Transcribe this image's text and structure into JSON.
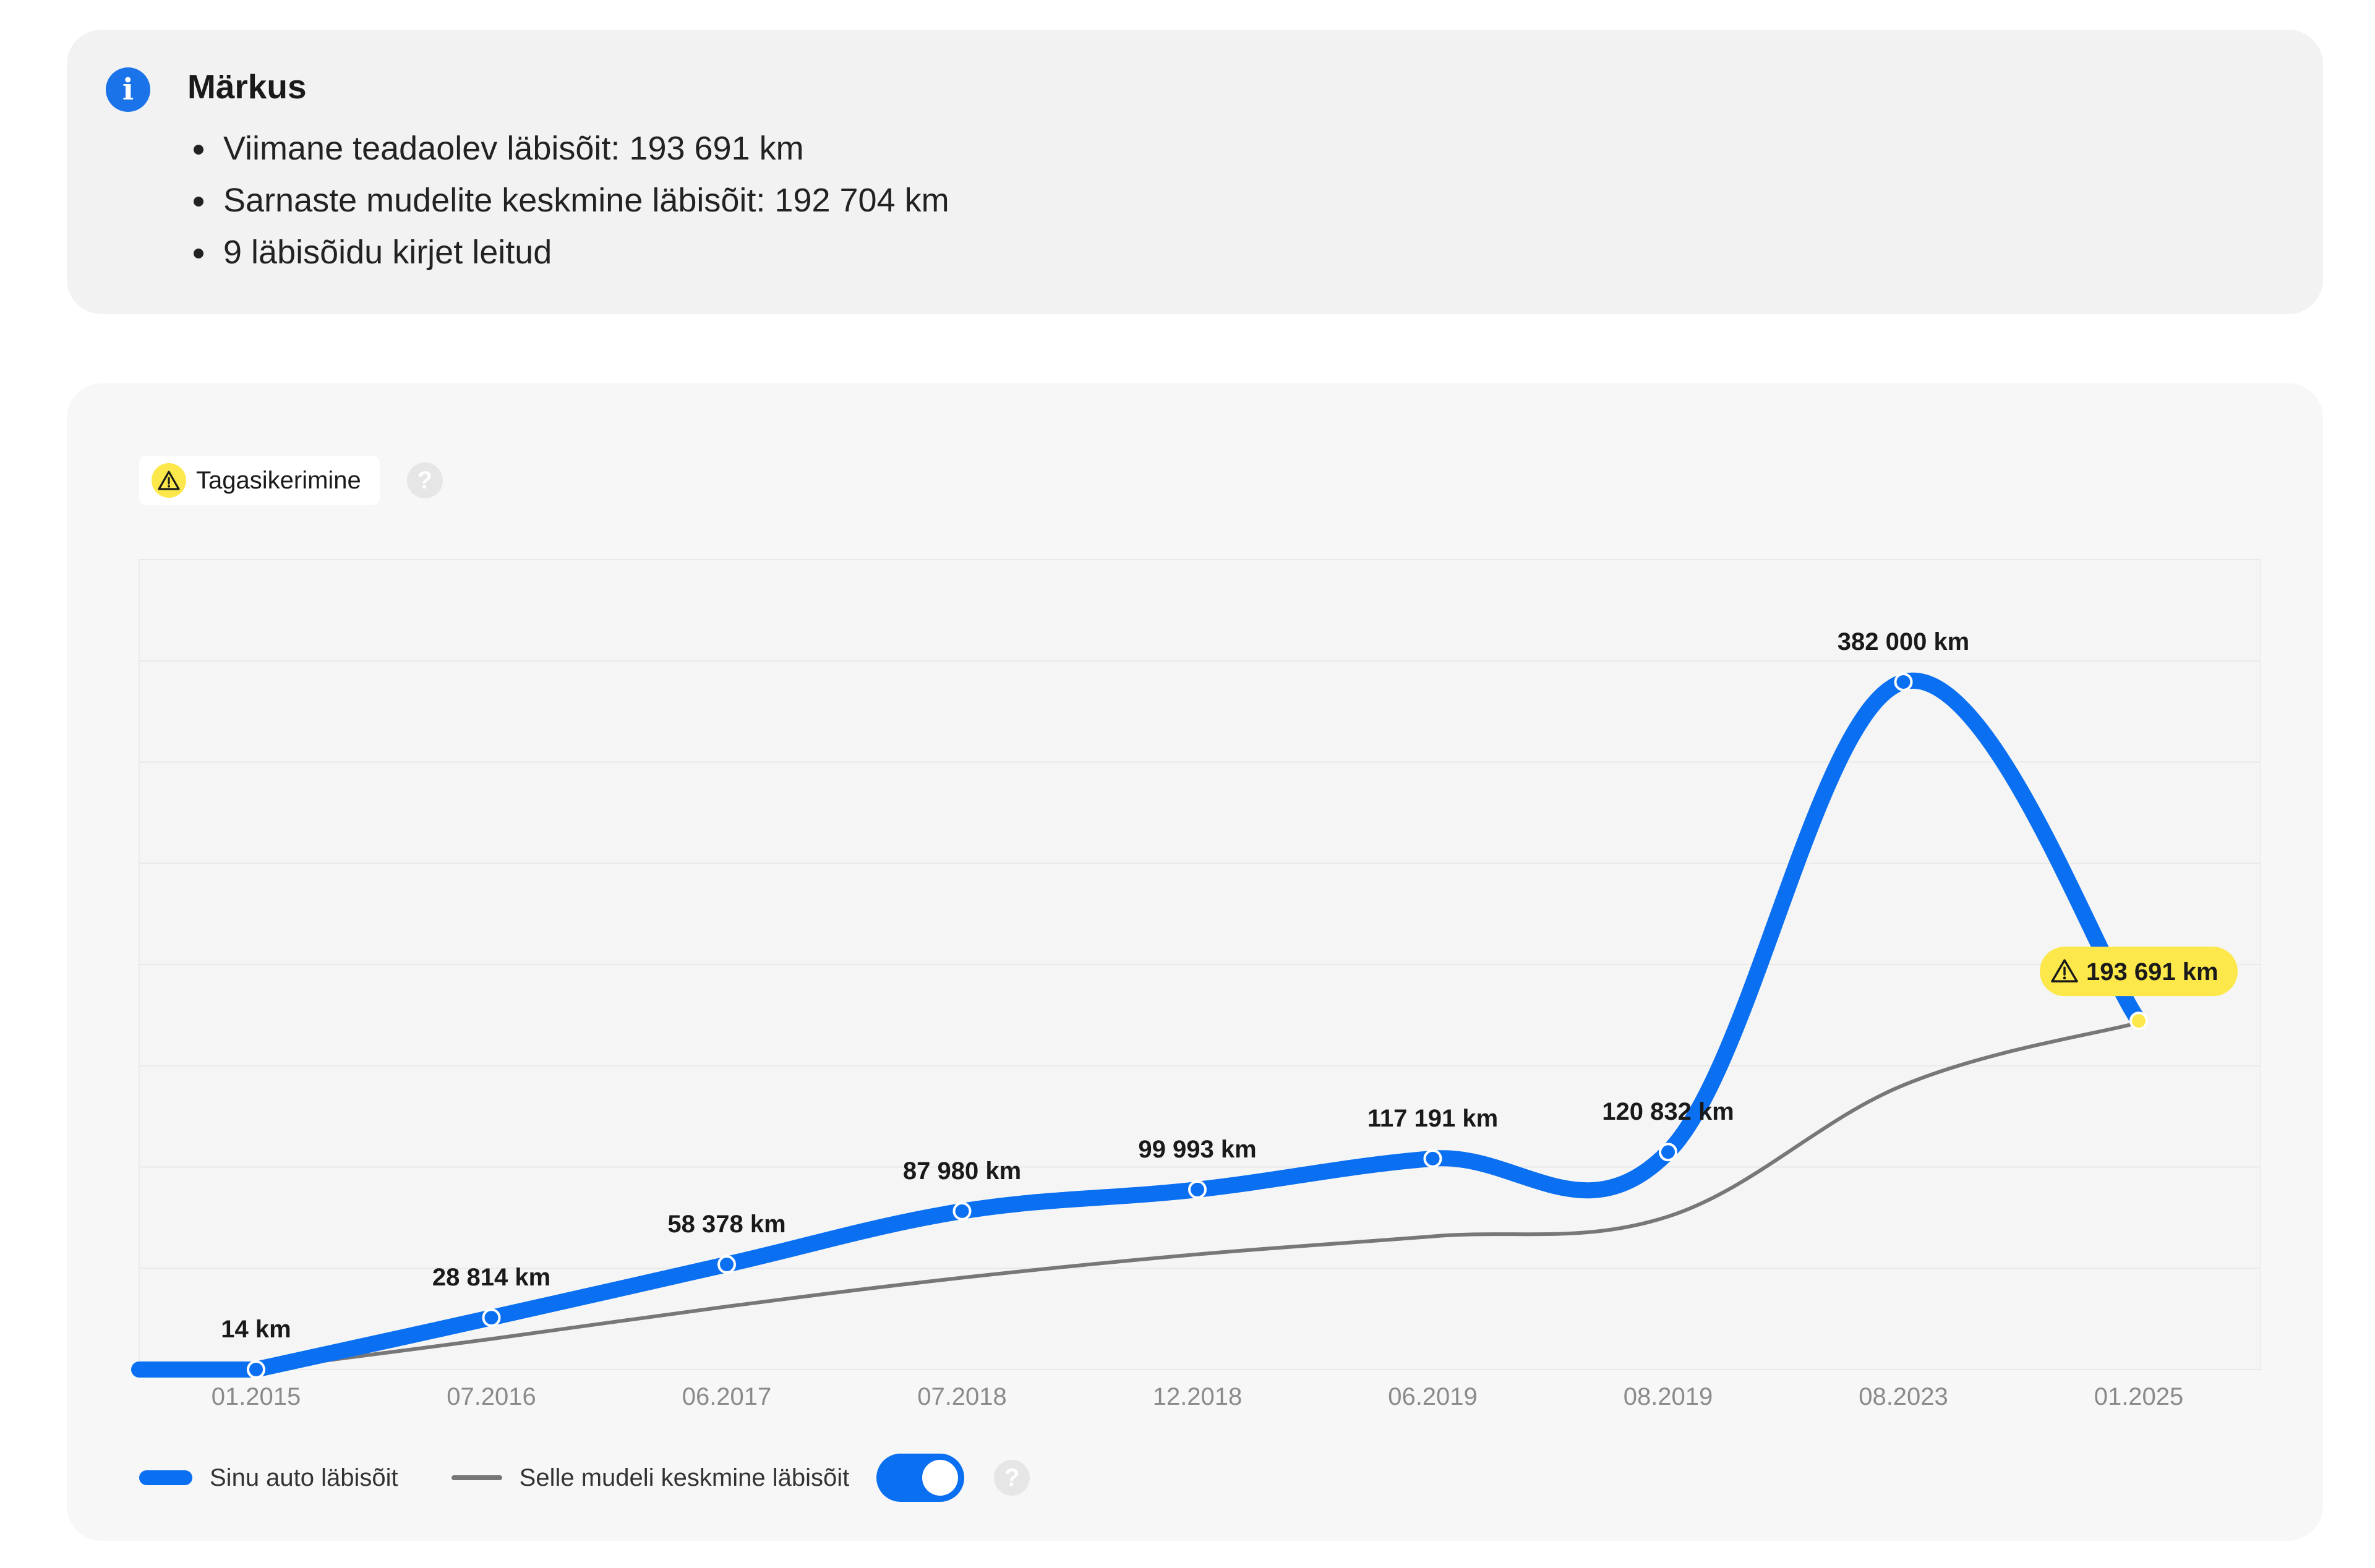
{
  "note": {
    "title": "Märkus",
    "items": [
      "Viimane teadaolev läbisõit: 193 691 km",
      "Sarnaste mudelite keskmine läbisõit: 192 704 km",
      "9 läbisõidu kirjet leitud"
    ],
    "icon": "info-icon",
    "icon_glyph": "i"
  },
  "badge": {
    "label": "Tagasikerimine",
    "icon": "warning-icon"
  },
  "help_glyph": "?",
  "colors": {
    "accent": "#0a6ff0",
    "average_line": "#777777",
    "warning": "#fde84b",
    "info": "#1a73e8"
  },
  "chart_data": {
    "type": "line",
    "categories": [
      "01.2015",
      "07.2016",
      "06.2017",
      "07.2018",
      "12.2018",
      "06.2019",
      "08.2019",
      "08.2023",
      "01.2025"
    ],
    "series": [
      {
        "name": "Sinu auto läbisõit",
        "values": [
          14,
          28814,
          58378,
          87980,
          99993,
          117191,
          120832,
          382000,
          193691
        ],
        "labels": [
          "14 km",
          "28 814 km",
          "58 378 km",
          "87 980 km",
          "99 993 km",
          "117 191 km",
          "120 832 km",
          "382 000 km",
          "193 691 km"
        ],
        "warning_index": 8,
        "color": "#0a6ff0"
      },
      {
        "name": "Selle mudeli keskmine läbisõit",
        "values": [
          14,
          17000,
          35000,
          51000,
          64000,
          74000,
          85000,
          158000,
          192704
        ],
        "color": "#777777"
      }
    ],
    "ylim": [
      0,
      450000
    ],
    "grid": true,
    "legend": "bottom-left",
    "toggle_on": true
  }
}
